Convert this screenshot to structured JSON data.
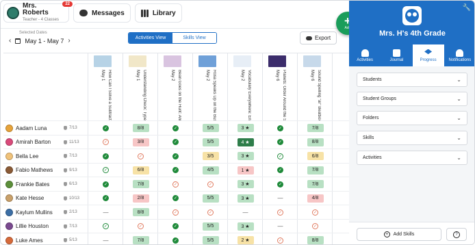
{
  "topbar": {
    "user_name": "Mrs. Roberts",
    "user_subtitle": "Teacher - 4 Classes",
    "notification_count": "22",
    "messages_label": "Messages",
    "library_label": "Library"
  },
  "fab": {
    "label": "Add"
  },
  "toolbar": {
    "selected_dates_label": "Selected Dates",
    "date_range": "May 1 - May 7",
    "activities_view_label": "Activities View",
    "skills_view_label": "Skills View",
    "export_label": "Export"
  },
  "columns": [
    {
      "date": "May 1",
      "title": "How Can I Solve a Subtraction Word...",
      "thumb": "#b7d3e6"
    },
    {
      "date": "May 1",
      "title": "Understanding Check: Types of Angles",
      "thumb": "#f1e7c8"
    },
    {
      "date": "May 2",
      "title": "Bean Goes on the Hunt: Animation",
      "thumb": "#d9c4e0"
    },
    {
      "date": "May 2",
      "title": "Rosa Speaks Up on the Bus: Summari...",
      "thumb": "#6fa0d8"
    },
    {
      "date": "May 2",
      "title": "Vocabulary Everywhere: Entrepreneurship",
      "thumb": "#e7eef6"
    },
    {
      "date": "May 6",
      "title": "Planets: Order Around the Sun",
      "thumb": "#3b2c6b"
    },
    {
      "date": "May 6",
      "title": "Sound Spelling \"ar\" Beatbox Segment...",
      "thumb": "#c7d9ea"
    }
  ],
  "students": [
    {
      "name": "Aadam Luna",
      "score": "7/13",
      "avatar": "#e7a33a",
      "cells": [
        {
          "t": "check"
        },
        {
          "t": "score",
          "v": "8/8",
          "c": "green"
        },
        {
          "t": "check"
        },
        {
          "t": "score",
          "v": "5/5",
          "c": "green"
        },
        {
          "t": "score",
          "v": "3 ★",
          "c": "green"
        },
        {
          "t": "check"
        },
        {
          "t": "score",
          "v": "7/8",
          "c": "green"
        }
      ]
    },
    {
      "name": "Amirah Barton",
      "score": "11/13",
      "avatar": "#d94a7a",
      "cells": [
        {
          "t": "check-red"
        },
        {
          "t": "score",
          "v": "3/8",
          "c": "red"
        },
        {
          "t": "check"
        },
        {
          "t": "score",
          "v": "5/5",
          "c": "green"
        },
        {
          "t": "score",
          "v": "4 ★",
          "c": "dark"
        },
        {
          "t": "check"
        },
        {
          "t": "score",
          "v": "8/8",
          "c": "green"
        }
      ]
    },
    {
      "name": "Bella Lee",
      "score": "7/13",
      "avatar": "#f0c27a",
      "cells": [
        {
          "t": "check"
        },
        {
          "t": "check-red"
        },
        {
          "t": "check"
        },
        {
          "t": "score",
          "v": "3/5",
          "c": "yellow"
        },
        {
          "t": "score",
          "v": "3 ★",
          "c": "green"
        },
        {
          "t": "check-outline"
        },
        {
          "t": "score",
          "v": "6/8",
          "c": "yellow"
        }
      ]
    },
    {
      "name": "Fabio Mathews",
      "score": "9/13",
      "avatar": "#8a5a36",
      "cells": [
        {
          "t": "check-outline"
        },
        {
          "t": "score",
          "v": "6/8",
          "c": "yellow"
        },
        {
          "t": "check"
        },
        {
          "t": "score",
          "v": "4/5",
          "c": "green"
        },
        {
          "t": "score",
          "v": "1 ★",
          "c": "red"
        },
        {
          "t": "check"
        },
        {
          "t": "score",
          "v": "7/8",
          "c": "green"
        }
      ]
    },
    {
      "name": "Frankie Bates",
      "score": "6/13",
      "avatar": "#5c8f3a",
      "cells": [
        {
          "t": "check"
        },
        {
          "t": "score",
          "v": "7/8",
          "c": "green"
        },
        {
          "t": "check-red"
        },
        {
          "t": "check-red"
        },
        {
          "t": "score",
          "v": "3 ★",
          "c": "green"
        },
        {
          "t": "check"
        },
        {
          "t": "score",
          "v": "7/8",
          "c": "green"
        }
      ]
    },
    {
      "name": "Kate Hesse",
      "score": "10/13",
      "avatar": "#c9a06a",
      "cells": [
        {
          "t": "check"
        },
        {
          "t": "score",
          "v": "2/8",
          "c": "red"
        },
        {
          "t": "check"
        },
        {
          "t": "score",
          "v": "5/5",
          "c": "green"
        },
        {
          "t": "score",
          "v": "3 ★",
          "c": "green"
        },
        {
          "t": "dash"
        },
        {
          "t": "score",
          "v": "4/8",
          "c": "red"
        }
      ]
    },
    {
      "name": "Kaylum Mullins",
      "score": "2/13",
      "avatar": "#3b6ea5",
      "cells": [
        {
          "t": "dash"
        },
        {
          "t": "score",
          "v": "8/8",
          "c": "green"
        },
        {
          "t": "check-red"
        },
        {
          "t": "check-red"
        },
        {
          "t": "dash"
        },
        {
          "t": "check-red"
        },
        {
          "t": "check-red"
        }
      ]
    },
    {
      "name": "Lillie Houston",
      "score": "7/13",
      "avatar": "#7a4a8f",
      "cells": [
        {
          "t": "check-outline"
        },
        {
          "t": "check-red"
        },
        {
          "t": "check"
        },
        {
          "t": "score",
          "v": "5/5",
          "c": "green"
        },
        {
          "t": "score",
          "v": "3 ★",
          "c": "green"
        },
        {
          "t": "dash"
        },
        {
          "t": "check-red"
        }
      ]
    },
    {
      "name": "Luke Ames",
      "score": "5/13",
      "avatar": "#d66a3a",
      "cells": [
        {
          "t": "dash"
        },
        {
          "t": "score",
          "v": "7/8",
          "c": "green"
        },
        {
          "t": "check"
        },
        {
          "t": "score",
          "v": "5/5",
          "c": "green"
        },
        {
          "t": "score",
          "v": "2 ★",
          "c": "yellow"
        },
        {
          "t": "check-red"
        },
        {
          "t": "score",
          "v": "8/8",
          "c": "green"
        }
      ]
    }
  ],
  "panel": {
    "class_name": "Mrs. H's 4th Grade",
    "tabs": [
      {
        "label": "Activities",
        "icon": "lightbulb-icon"
      },
      {
        "label": "Journal",
        "icon": "book-icon"
      },
      {
        "label": "Progress",
        "icon": "graduation-cap-icon"
      },
      {
        "label": "Notifications",
        "icon": "bell-icon"
      }
    ],
    "active_tab": "Progress",
    "filters": [
      "Students",
      "Student Groups",
      "Folders",
      "Skills",
      "Activities"
    ],
    "add_skills_label": "Add Skills",
    "help_label": "?"
  },
  "colors": {
    "brand_blue": "#1f6fc5",
    "fab_green": "#1a9d5a",
    "check_green": "#1f8a3a"
  }
}
